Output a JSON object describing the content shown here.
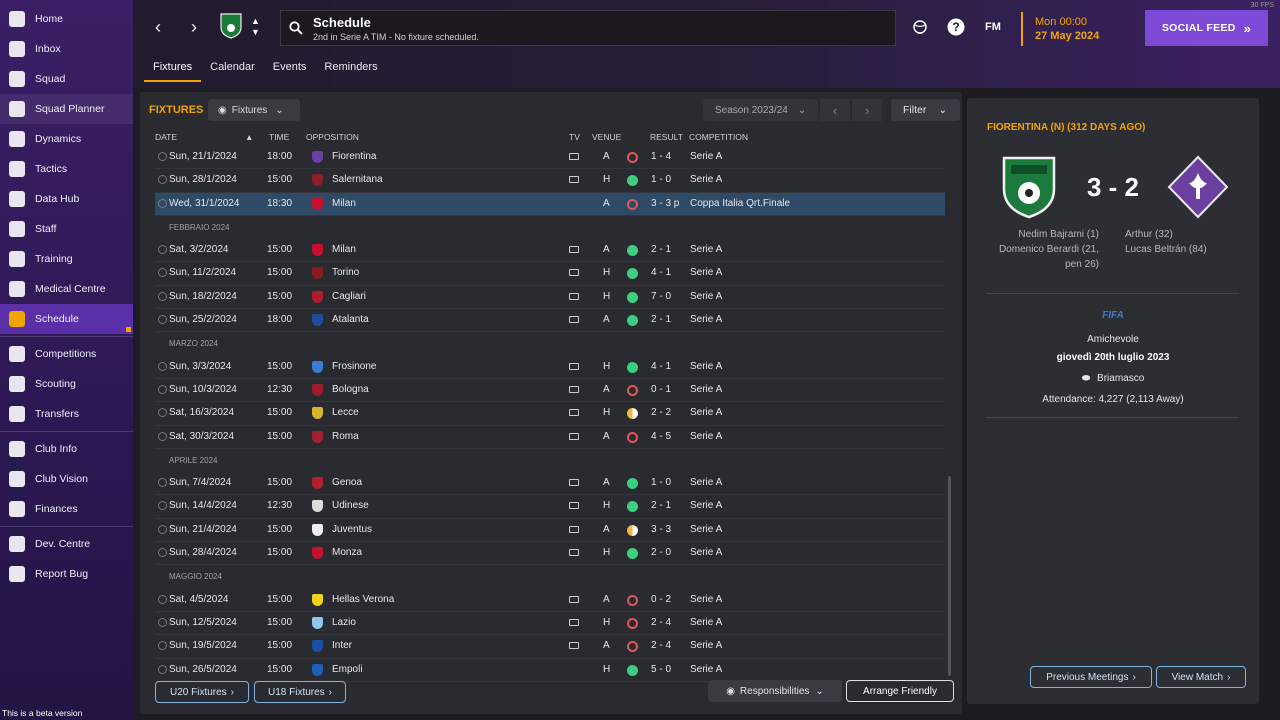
{
  "sidebar": {
    "items": [
      {
        "label": "Home",
        "icon": "home-icon"
      },
      {
        "label": "Inbox",
        "icon": "inbox-icon"
      },
      {
        "label": "Squad",
        "icon": "squad-icon"
      },
      {
        "label": "Squad Planner",
        "icon": "clipboard-icon"
      },
      {
        "label": "Dynamics",
        "icon": "dynamics-icon"
      },
      {
        "label": "Tactics",
        "icon": "tactics-icon"
      },
      {
        "label": "Data Hub",
        "icon": "data-hub-icon"
      },
      {
        "label": "Staff",
        "icon": "staff-icon"
      },
      {
        "label": "Training",
        "icon": "training-icon"
      },
      {
        "label": "Medical Centre",
        "icon": "medical-icon"
      },
      {
        "label": "Schedule",
        "icon": "calendar-icon"
      },
      {
        "label": "Competitions",
        "icon": "trophy-icon"
      },
      {
        "label": "Scouting",
        "icon": "search-icon"
      },
      {
        "label": "Transfers",
        "icon": "transfer-icon"
      },
      {
        "label": "Club Info",
        "icon": "shield-icon"
      },
      {
        "label": "Club Vision",
        "icon": "vision-icon"
      },
      {
        "label": "Finances",
        "icon": "finances-icon"
      },
      {
        "label": "Dev. Centre",
        "icon": "dev-centre-icon"
      },
      {
        "label": "Report Bug",
        "icon": "bug-icon"
      }
    ],
    "beta_text": "This is a beta version"
  },
  "header": {
    "title": "Schedule",
    "subtitle": "2nd in Serie A TIM - No fixture scheduled.",
    "fm_label": "FM",
    "date_time": "Mon 00:00",
    "date_day": "27 May 2024",
    "social_label": "SOCIAL FEED",
    "fps": "30 FPS"
  },
  "tabs": [
    "Fixtures",
    "Calendar",
    "Events",
    "Reminders"
  ],
  "fixtures": {
    "section_label": "FIXTURES",
    "view_dropdown": "Fixtures",
    "season": "Season 2023/24",
    "filter_label": "Filter",
    "columns": {
      "date": "DATE",
      "time": "TIME",
      "opposition": "OPPOSITION",
      "tv": "TV",
      "venue": "VENUE",
      "result": "RESULT",
      "competition": "COMPETITION"
    },
    "rows": [
      {
        "type": "match",
        "date": "Sun, 21/1/2024",
        "time": "18:00",
        "opp": "Fiorentina",
        "tv": true,
        "venue": "A",
        "res": "l",
        "score": "1 - 4",
        "comp": "Serie A",
        "crest": "#6a3fa0"
      },
      {
        "type": "match",
        "date": "Sun, 28/1/2024",
        "time": "15:00",
        "opp": "Salernitana",
        "tv": true,
        "venue": "H",
        "res": "w",
        "score": "1 - 0",
        "comp": "Serie A",
        "crest": "#8b1e2b"
      },
      {
        "type": "match",
        "date": "Wed, 31/1/2024",
        "time": "18:30",
        "opp": "Milan",
        "tv": false,
        "venue": "A",
        "res": "l",
        "score": "3 - 3 p",
        "comp": "Coppa Italia Qrt.Finale",
        "crest": "#c8102e",
        "hl": true
      },
      {
        "type": "month",
        "label": "FEBBRAIO 2024"
      },
      {
        "type": "match",
        "date": "Sat, 3/2/2024",
        "time": "15:00",
        "opp": "Milan",
        "tv": true,
        "venue": "A",
        "res": "w",
        "score": "2 - 1",
        "comp": "Serie A",
        "crest": "#c8102e"
      },
      {
        "type": "match",
        "date": "Sun, 11/2/2024",
        "time": "15:00",
        "opp": "Torino",
        "tv": true,
        "venue": "H",
        "res": "w",
        "score": "4 - 1",
        "comp": "Serie A",
        "crest": "#8a1c1c"
      },
      {
        "type": "match",
        "date": "Sun, 18/2/2024",
        "time": "15:00",
        "opp": "Cagliari",
        "tv": true,
        "venue": "H",
        "res": "w",
        "score": "7 - 0",
        "comp": "Serie A",
        "crest": "#b01c2e"
      },
      {
        "type": "match",
        "date": "Sun, 25/2/2024",
        "time": "18:00",
        "opp": "Atalanta",
        "tv": true,
        "venue": "A",
        "res": "w",
        "score": "2 - 1",
        "comp": "Serie A",
        "crest": "#1f4c9c"
      },
      {
        "type": "month",
        "label": "MARZO 2024"
      },
      {
        "type": "match",
        "date": "Sun, 3/3/2024",
        "time": "15:00",
        "opp": "Frosinone",
        "tv": true,
        "venue": "H",
        "res": "w",
        "score": "4 - 1",
        "comp": "Serie A",
        "crest": "#3a7bd5"
      },
      {
        "type": "match",
        "date": "Sun, 10/3/2024",
        "time": "12:30",
        "opp": "Bologna",
        "tv": true,
        "venue": "A",
        "res": "l",
        "score": "0 - 1",
        "comp": "Serie A",
        "crest": "#9b1c2c"
      },
      {
        "type": "match",
        "date": "Sat, 16/3/2024",
        "time": "15:00",
        "opp": "Lecce",
        "tv": true,
        "venue": "H",
        "res": "d",
        "score": "2 - 2",
        "comp": "Serie A",
        "crest": "#d8b52c"
      },
      {
        "type": "match",
        "date": "Sat, 30/3/2024",
        "time": "15:00",
        "opp": "Roma",
        "tv": true,
        "venue": "A",
        "res": "l",
        "score": "4 - 5",
        "comp": "Serie A",
        "crest": "#a3202e"
      },
      {
        "type": "month",
        "label": "APRILE 2024"
      },
      {
        "type": "match",
        "date": "Sun, 7/4/2024",
        "time": "15:00",
        "opp": "Genoa",
        "tv": true,
        "venue": "A",
        "res": "w",
        "score": "1 - 0",
        "comp": "Serie A",
        "crest": "#b3202e"
      },
      {
        "type": "match",
        "date": "Sun, 14/4/2024",
        "time": "12:30",
        "opp": "Udinese",
        "tv": true,
        "venue": "H",
        "res": "w",
        "score": "2 - 1",
        "comp": "Serie A",
        "crest": "#dddddd"
      },
      {
        "type": "match",
        "date": "Sun, 21/4/2024",
        "time": "15:00",
        "opp": "Juventus",
        "tv": true,
        "venue": "A",
        "res": "d",
        "score": "3 - 3",
        "comp": "Serie A",
        "crest": "#eeeeee"
      },
      {
        "type": "match",
        "date": "Sun, 28/4/2024",
        "time": "15:00",
        "opp": "Monza",
        "tv": true,
        "venue": "H",
        "res": "w",
        "score": "2 - 0",
        "comp": "Serie A",
        "crest": "#c8102e"
      },
      {
        "type": "month",
        "label": "MAGGIO 2024"
      },
      {
        "type": "match",
        "date": "Sat, 4/5/2024",
        "time": "15:00",
        "opp": "Hellas Verona",
        "tv": true,
        "venue": "A",
        "res": "l",
        "score": "0 - 2",
        "comp": "Serie A",
        "crest": "#f2d21b"
      },
      {
        "type": "match",
        "date": "Sun, 12/5/2024",
        "time": "15:00",
        "opp": "Lazio",
        "tv": true,
        "venue": "H",
        "res": "l",
        "score": "2 - 4",
        "comp": "Serie A",
        "crest": "#8fc7ea"
      },
      {
        "type": "match",
        "date": "Sun, 19/5/2024",
        "time": "15:00",
        "opp": "Inter",
        "tv": true,
        "venue": "A",
        "res": "l",
        "score": "2 - 4",
        "comp": "Serie A",
        "crest": "#1d4fa5"
      },
      {
        "type": "match",
        "date": "Sun, 26/5/2024",
        "time": "15:00",
        "opp": "Empoli",
        "tv": false,
        "venue": "H",
        "res": "w",
        "score": "5 - 0",
        "comp": "Serie A",
        "crest": "#1f5fb8"
      }
    ],
    "u20_label": "U20 Fixtures",
    "u18_label": "U18 Fixtures",
    "responsibilities_label": "Responsibilities",
    "arrange_label": "Arrange Friendly"
  },
  "detail": {
    "title": "FIORENTINA (N) (312 DAYS AGO)",
    "score": "3 - 2",
    "home_scorers": "Nedim Bajrami (1)\nDomenico Berardi (21, pen 26)",
    "away_scorers": "Arthur (32)\nLucas Beltrán (84)",
    "organizer": "FIFA",
    "competition": "Amichevole",
    "date": "giovedì 20th luglio 2023",
    "venue": "Briamasco",
    "attendance": "Attendance: 4,227 (2,113 Away)",
    "prev_label": "Previous Meetings",
    "view_label": "View Match"
  }
}
